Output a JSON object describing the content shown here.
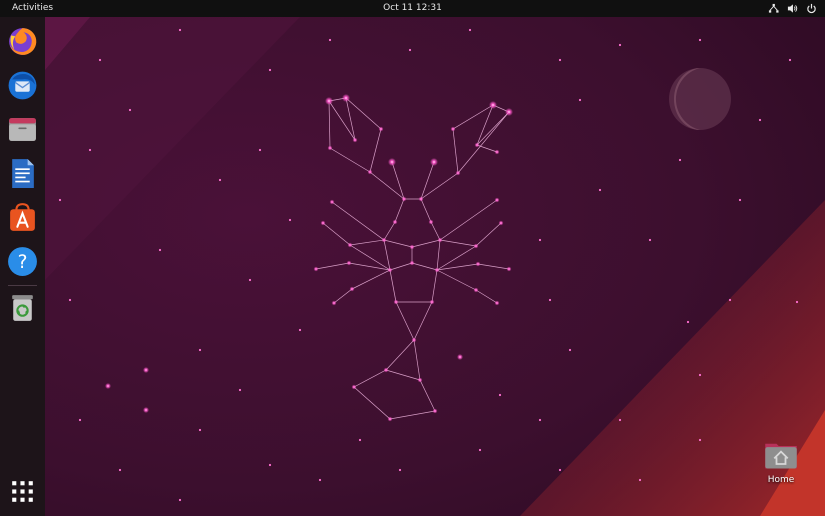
{
  "topbar": {
    "activities_label": "Activities",
    "clock": "Oct 11  12:31"
  },
  "dock": {
    "items": [
      {
        "name": "firefox",
        "icon": "firefox-icon"
      },
      {
        "name": "thunderbird",
        "icon": "thunderbird-icon"
      },
      {
        "name": "files",
        "icon": "files-icon"
      },
      {
        "name": "libreoffice-writer",
        "icon": "writer-icon"
      },
      {
        "name": "ubuntu-software",
        "icon": "software-icon"
      },
      {
        "name": "help",
        "icon": "help-icon"
      },
      {
        "name": "trash",
        "icon": "trash-icon"
      },
      {
        "name": "show-applications",
        "icon": "app-grid-icon"
      }
    ]
  },
  "desktop": {
    "home_label": "Home"
  },
  "colors": {
    "topbar": "#101010",
    "dock": "#1d1419",
    "wallpaper_base": "#3a0d2c",
    "star": "#ff4fc3",
    "accent_orange": "#e95420"
  }
}
